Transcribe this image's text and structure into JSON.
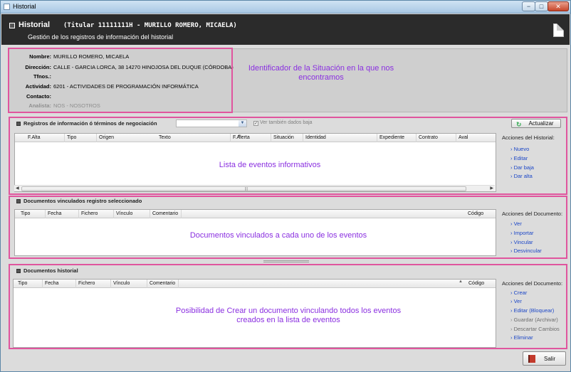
{
  "window": {
    "title": "Historial",
    "buttons": {
      "minimize": "−",
      "maximize": "□",
      "close": "✕"
    }
  },
  "header": {
    "title": "Historial",
    "titular": "(Titular 11111111H - MURILLO ROMERO, MICAELA)",
    "subtitle": "Gestión de los registros de información del historial"
  },
  "info": {
    "nombre_label": "Nombre:",
    "nombre": "MURILLO ROMERO, MICAELA",
    "direccion_label": "Dirección:",
    "direccion": "CALLE - GARCIA LORCA, 38  14270 HINOJOSA DEL DUQUE (CÓRDOBA)",
    "tfnos_label": "Tfnos.:",
    "tfnos": "",
    "actividad_label": "Actividad:",
    "actividad": "6201 - ACTIVIDADES DE PROGRAMACIÓN INFORMÁTICA",
    "contacto_label": "Contacto:",
    "contacto": "",
    "analista_label": "Analista:",
    "analista": "NOS - NOSOTROS"
  },
  "annotations": {
    "info": "Identificador de la Situación en la que nos encontramos",
    "registros": "Lista de eventos informativos",
    "vinculados": "Documentos vinculados a cada uno de los eventos",
    "historial": "Posibilidad de Crear un documento vinculando todos los eventos creados en la lista de eventos"
  },
  "registros": {
    "title": "Registros de información ó términos de negociación",
    "combo_value": "",
    "checkbox_label": "Ver también dados baja",
    "checkbox_checked": true,
    "refresh_label": "Actualizar",
    "columns": [
      "F.Alta",
      "Tipo",
      "Origen",
      "Texto",
      "F.Alerta",
      "Situación",
      "Identidad",
      "Expediente",
      "Contrato",
      "Aval"
    ],
    "actions_title": "Acciones del Historial:",
    "actions": [
      "Nuevo",
      "Editar",
      "Dar baja",
      "Dar alta"
    ]
  },
  "vinculados": {
    "title": "Documentos vinculados registro seleccionado",
    "columns": [
      "Tipo",
      "Fecha",
      "Fichero",
      "Vínculo",
      "Comentario",
      "Código"
    ],
    "actions_title": "Acciones del Documento:",
    "actions": [
      "Ver",
      "Importar",
      "Vincular",
      "Desvincular"
    ]
  },
  "historial_docs": {
    "title": "Documentos historial",
    "columns": [
      "Tipo",
      "Fecha",
      "Fichero",
      "Vínculo",
      "Comentario",
      "Código"
    ],
    "actions_title": "Acciones del Documento:",
    "actions": [
      "Crear",
      "Ver",
      "Editar (Bloquear)",
      "Guardar (Archivar)",
      "Descartar Cambios",
      "Eliminar"
    ]
  },
  "footer": {
    "exit_label": "Salir"
  },
  "colors": {
    "annotation": "#8a2fe0",
    "highlight": "#e0559e",
    "link": "#1b46c7",
    "header_bg": "#2b2b2b"
  }
}
